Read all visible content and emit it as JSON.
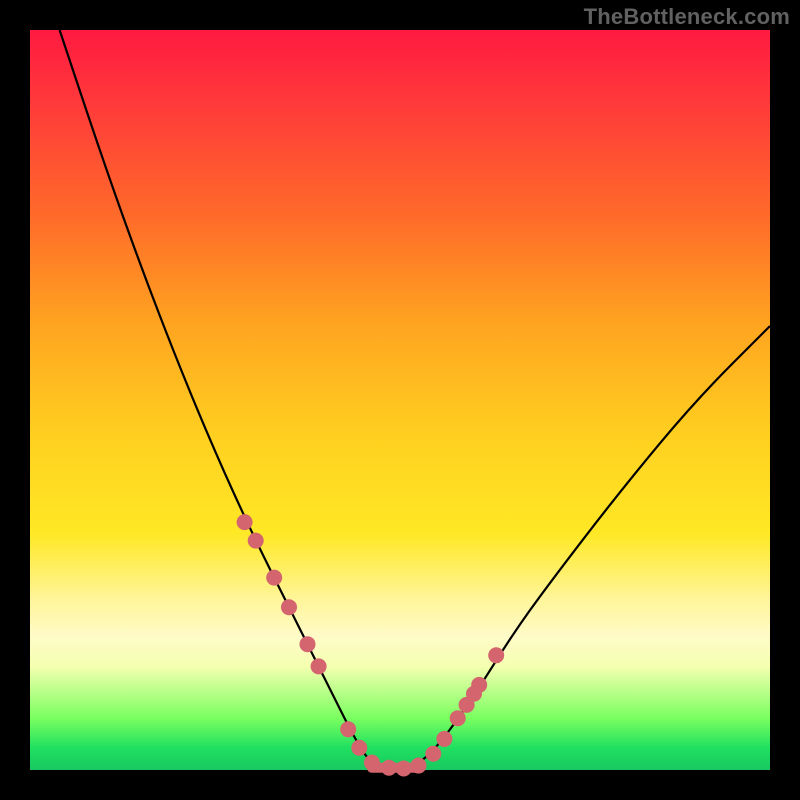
{
  "attribution": "TheBottleneck.com",
  "colors": {
    "dot": "#d4646e",
    "curve": "#000000",
    "frame_bg_top": "#ff1a40",
    "frame_bg_bottom": "#18c860"
  },
  "chart_data": {
    "type": "line",
    "title": "",
    "xlabel": "",
    "ylabel": "",
    "xlim": [
      0,
      100
    ],
    "ylim": [
      0,
      100
    ],
    "grid": false,
    "series": [
      {
        "name": "bottleneck-curve",
        "x": [
          4,
          10,
          15,
          20,
          25,
          30,
          35,
          40,
          44,
          46,
          48,
          50,
          52,
          55,
          60,
          65,
          70,
          80,
          90,
          100
        ],
        "y": [
          100,
          82,
          68,
          55,
          43,
          32,
          22,
          12,
          4,
          1,
          0,
          0,
          0.5,
          3,
          10,
          18,
          25,
          38,
          50,
          60
        ]
      }
    ],
    "markers": {
      "name": "highlighted-points",
      "x": [
        29,
        30.5,
        33,
        35,
        37.5,
        39,
        43,
        44.5,
        46.2,
        48.5,
        50.5,
        52.5,
        54.5,
        56,
        57.8,
        59,
        60,
        60.7,
        63
      ],
      "y": [
        33.5,
        31,
        26,
        22,
        17,
        14,
        5.5,
        3,
        1,
        0.3,
        0.2,
        0.6,
        2.2,
        4.2,
        7,
        8.8,
        10.3,
        11.5,
        15.5
      ]
    },
    "flat_segment": {
      "x0": 46.2,
      "x1": 52.5,
      "y": 0.3
    }
  }
}
